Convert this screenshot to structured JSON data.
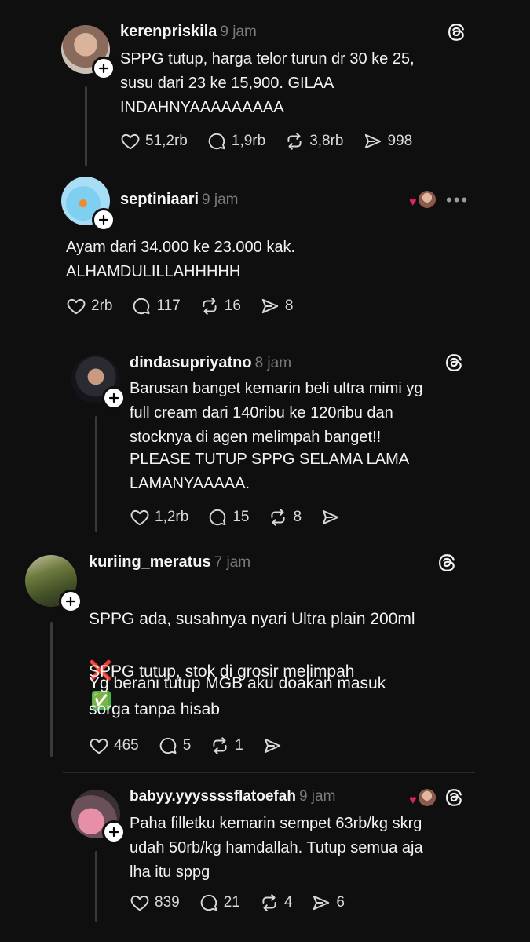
{
  "posts": [
    {
      "username": "kerenpriskila",
      "time": "9 jam",
      "text": "SPPG tutup, harga telor turun dr 30 ke 25,\nsusu dari 23 ke 15,900. GILAA\nINDAHNYAAAAAAAAA",
      "likes": "51,2rb",
      "replies": "1,9rb",
      "reposts": "3,8rb",
      "shares": "998"
    },
    {
      "username": "septiniaari",
      "time": "9 jam",
      "text": "Ayam dari 34.000 ke 23.000 kak.\nALHAMDULILLAHHHHH",
      "likes": "2rb",
      "replies": "117",
      "reposts": "16",
      "shares": "8"
    },
    {
      "username": "dindasupriyatno",
      "time": "8 jam",
      "text": "Barusan banget kemarin beli ultra mimi yg\nfull cream dari 140ribu ke 120ribu dan\nstocknya di agen melimpah banget!!",
      "text2": "PLEASE TUTUP SPPG SELAMA LAMA\nLAMANYAAAAA.",
      "likes": "1,2rb",
      "replies": "15",
      "reposts": "8",
      "shares": ""
    },
    {
      "username": "kuriing_meratus",
      "time": "7 jam",
      "text": "SPPG ada, susahnya nyari Ultra plain 200ml",
      "emoji1": "❌",
      "text2": "SPPG tutup, stok di grosir melimpah",
      "emoji2": "✅",
      "text3": "Yg berani tutup MGB aku doakan masuk\nsorga tanpa hisab",
      "likes": "465",
      "replies": "5",
      "reposts": "1",
      "shares": ""
    },
    {
      "username": "babyy.yyyssssflatoefah",
      "time": "9 jam",
      "text": "Paha filletku kemarin sempet 63rb/kg skrg\nudah 50rb/kg hamdallah. Tutup semua aja\nlha itu sppg",
      "likes": "839",
      "replies": "21",
      "reposts": "4",
      "shares": "6"
    }
  ],
  "icons": {
    "like": "heart-icon",
    "reply": "comment-icon",
    "repost": "repost-icon",
    "share": "send-icon",
    "more": "more-icon",
    "logo": "threads-logo-icon",
    "follow": "plus-icon"
  },
  "colors": {
    "background": "#0f0f0f",
    "text": "#f3f3f3",
    "muted": "#7b7b7b",
    "heart_badge": "#e0245e"
  }
}
